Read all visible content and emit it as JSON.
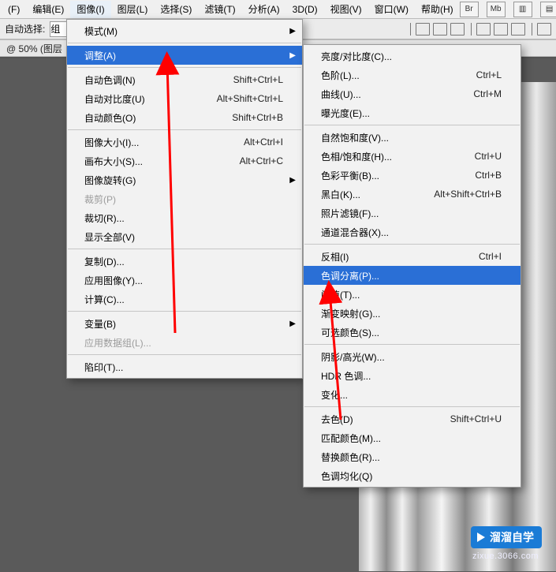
{
  "menubar": {
    "items": [
      {
        "label": "(F)"
      },
      {
        "label": "编辑(E)"
      },
      {
        "label": "图像(I)"
      },
      {
        "label": "图层(L)"
      },
      {
        "label": "选择(S)"
      },
      {
        "label": "滤镜(T)"
      },
      {
        "label": "分析(A)"
      },
      {
        "label": "3D(D)"
      },
      {
        "label": "视图(V)"
      },
      {
        "label": "窗口(W)"
      },
      {
        "label": "帮助(H)"
      }
    ],
    "file_icons": [
      {
        "txt": "Br"
      },
      {
        "txt": "Mb"
      },
      {
        "txt": "▥"
      },
      {
        "txt": "▤"
      }
    ]
  },
  "toolbar": {
    "auto_select_label": "自动选择:",
    "select_value": "组"
  },
  "status": {
    "text": "@ 50% (图层"
  },
  "menu1": {
    "rows": [
      {
        "label": "模式(M)",
        "arrow": true
      },
      {
        "sep": true
      },
      {
        "label": "调整(A)",
        "arrow": true,
        "hl": true
      },
      {
        "sep": true
      },
      {
        "label": "自动色调(N)",
        "accel": "Shift+Ctrl+L"
      },
      {
        "label": "自动对比度(U)",
        "accel": "Alt+Shift+Ctrl+L"
      },
      {
        "label": "自动颜色(O)",
        "accel": "Shift+Ctrl+B"
      },
      {
        "sep": true
      },
      {
        "label": "图像大小(I)...",
        "accel": "Alt+Ctrl+I"
      },
      {
        "label": "画布大小(S)...",
        "accel": "Alt+Ctrl+C"
      },
      {
        "label": "图像旋转(G)",
        "arrow": true
      },
      {
        "label": "裁剪(P)",
        "disabled": true
      },
      {
        "label": "裁切(R)..."
      },
      {
        "label": "显示全部(V)"
      },
      {
        "sep": true
      },
      {
        "label": "复制(D)..."
      },
      {
        "label": "应用图像(Y)..."
      },
      {
        "label": "计算(C)..."
      },
      {
        "sep": true
      },
      {
        "label": "变量(B)",
        "arrow": true
      },
      {
        "label": "应用数据组(L)...",
        "disabled": true
      },
      {
        "sep": true
      },
      {
        "label": "陷印(T)..."
      }
    ]
  },
  "menu2": {
    "rows": [
      {
        "label": "亮度/对比度(C)..."
      },
      {
        "label": "色阶(L)...",
        "accel": "Ctrl+L"
      },
      {
        "label": "曲线(U)...",
        "accel": "Ctrl+M"
      },
      {
        "label": "曝光度(E)..."
      },
      {
        "sep": true
      },
      {
        "label": "自然饱和度(V)..."
      },
      {
        "label": "色相/饱和度(H)...",
        "accel": "Ctrl+U"
      },
      {
        "label": "色彩平衡(B)...",
        "accel": "Ctrl+B"
      },
      {
        "label": "黑白(K)...",
        "accel": "Alt+Shift+Ctrl+B"
      },
      {
        "label": "照片滤镜(F)..."
      },
      {
        "label": "通道混合器(X)..."
      },
      {
        "sep": true
      },
      {
        "label": "反相(I)",
        "accel": "Ctrl+I"
      },
      {
        "label": "色调分离(P)...",
        "hl": true
      },
      {
        "label": "阈值(T)..."
      },
      {
        "label": "渐变映射(G)..."
      },
      {
        "label": "可选颜色(S)..."
      },
      {
        "sep": true
      },
      {
        "label": "阴影/高光(W)..."
      },
      {
        "label": "HDR 色调..."
      },
      {
        "label": "变化..."
      },
      {
        "sep": true
      },
      {
        "label": "去色(D)",
        "accel": "Shift+Ctrl+U"
      },
      {
        "label": "匹配颜色(M)..."
      },
      {
        "label": "替换颜色(R)..."
      },
      {
        "label": "色调均化(Q)"
      }
    ]
  },
  "watermark": {
    "brand": "溜溜自学",
    "url": "zixue.3066.com"
  }
}
